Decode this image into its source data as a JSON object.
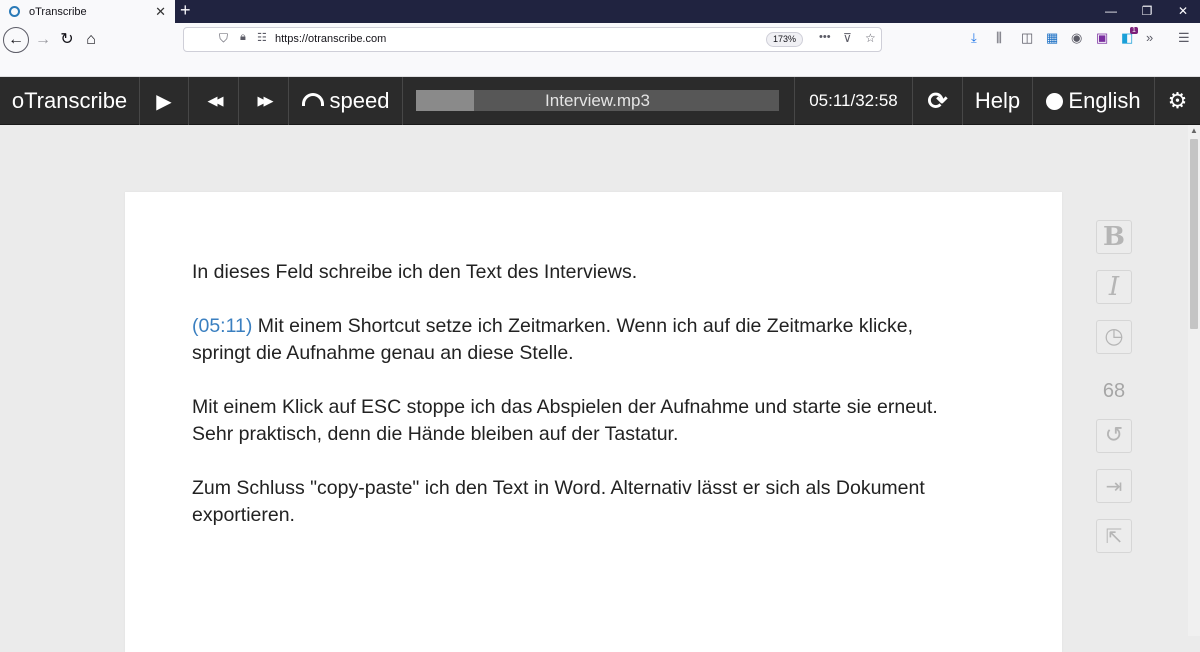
{
  "browser": {
    "tab_title": "oTranscribe",
    "tab_close": "✕",
    "new_tab": "+",
    "window_controls": [
      "—",
      "❐",
      "✕"
    ],
    "url": "https://otranscribe.com",
    "zoom": "173%",
    "page_actions": "•••",
    "notification_badge": "1"
  },
  "toolbar": {
    "app_name": "oTranscribe",
    "play_icon": "▶",
    "rewind_icon": "◀◀",
    "forward_icon": "▶▶",
    "speed_label": "speed",
    "filename": "Interview.mp3",
    "progress_fraction": 0.16,
    "time": "05:11/32:58",
    "reset_icon": "⟳",
    "help_label": "Help",
    "language_label": "English",
    "settings_icon": "⚙"
  },
  "document": {
    "para1": "In dieses Feld schreibe ich den Text des Interviews.",
    "timestamp": "(05:11)",
    "para2_line1": "Mit einem Shortcut setze ich Zeitmarken. Wenn ich auf die Zeitmarke klicke,",
    "para2_line2": "springt die Aufnahme genau an diese Stelle.",
    "para3_line1": "Mit einem Klick auf ESC stoppe ich das Abspielen der Aufnahme und starte sie erneut.",
    "para3_line2": "Sehr praktisch, denn die Hände bleiben auf der Tastatur.",
    "para4_line1": "Zum Schluss \"copy-paste\" ich den Text in Word. Alternativ lässt er sich als Dokument",
    "para4_line2": "exportieren."
  },
  "sidebar": {
    "bold": "B",
    "italic": "I",
    "word_count": "68"
  },
  "colors": {
    "toolbar_bg": "#2b2b2b",
    "timestamp": "#3a7fc0",
    "page_bg": "#ebebeb"
  }
}
